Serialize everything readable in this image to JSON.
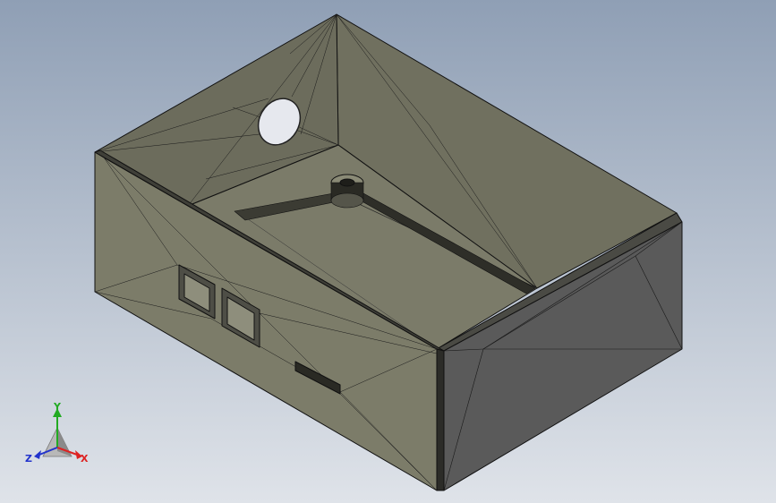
{
  "viewport": {
    "background_top": "#8f9fb5",
    "background_bottom": "#dfe3e9",
    "model": {
      "name": "enclosure-box",
      "face_color": "#7a7a68",
      "wall_dark": "#555555",
      "edge_color": "#111111"
    }
  },
  "triad": {
    "x_label": "X",
    "y_label": "Y",
    "z_label": "Z",
    "x_color": "#dd2222",
    "y_color": "#22aa22",
    "z_color": "#2233cc"
  }
}
